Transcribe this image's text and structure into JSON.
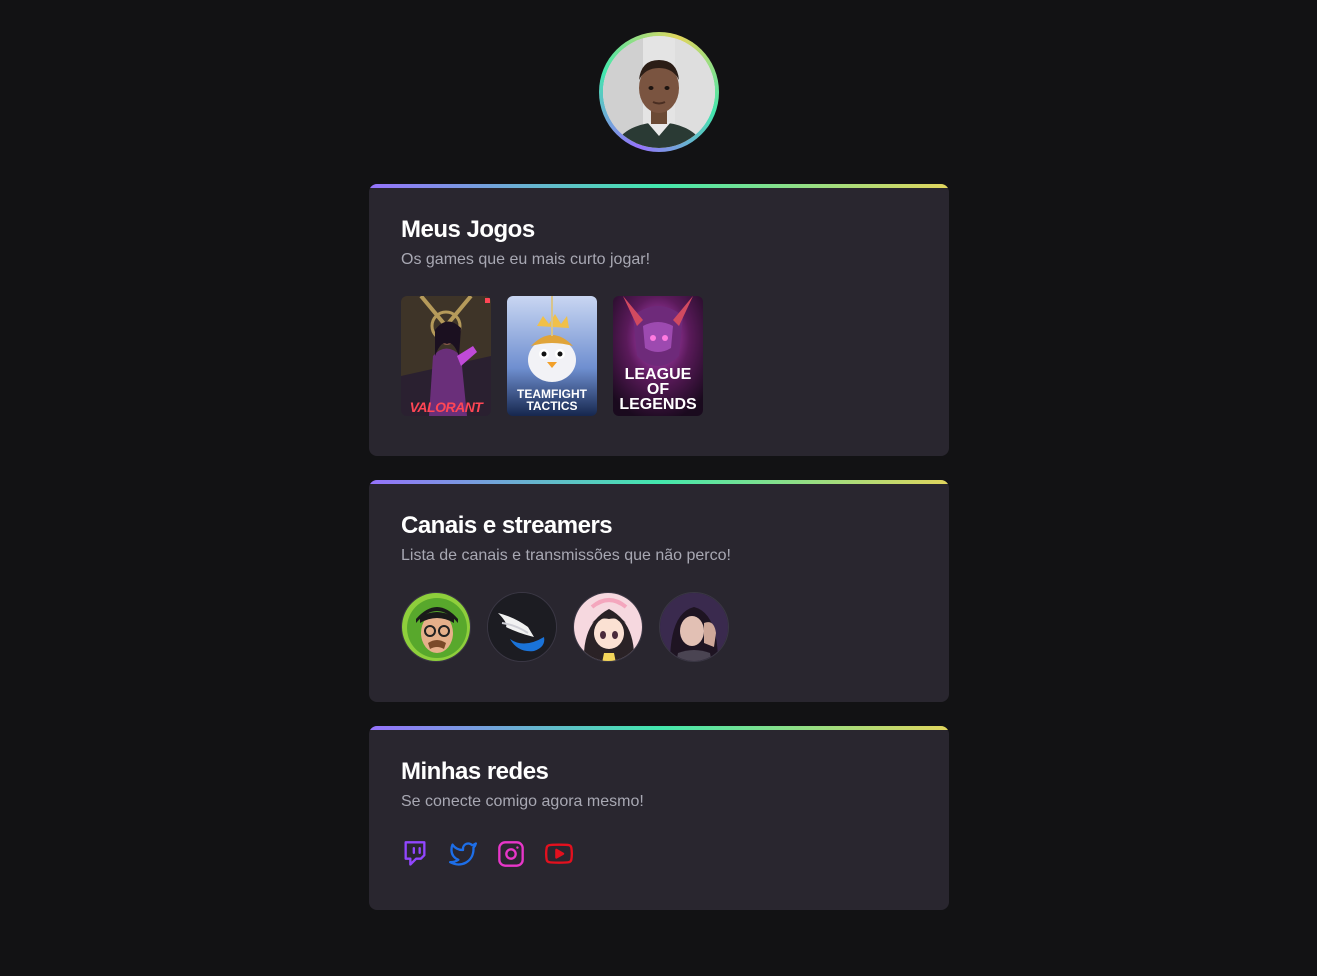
{
  "profile": {
    "avatar_icon": "profile-photo"
  },
  "sections": {
    "games": {
      "title": "Meus Jogos",
      "subtitle": "Os games que eu mais curto jogar!",
      "items": [
        {
          "name": "VALORANT"
        },
        {
          "name": "TEAMFIGHT TACTICS"
        },
        {
          "name": "LEAGUE OF LEGENDS"
        }
      ]
    },
    "channels": {
      "title": "Canais e streamers",
      "subtitle": "Lista de canais e transmissões que não perco!",
      "items": [
        {
          "icon": "streamer-avatar-1"
        },
        {
          "icon": "streamer-avatar-2"
        },
        {
          "icon": "streamer-avatar-3"
        },
        {
          "icon": "streamer-avatar-4"
        }
      ]
    },
    "socials": {
      "title": "Minhas redes",
      "subtitle": "Se conecte comigo agora mesmo!",
      "items": [
        {
          "icon": "twitch-icon",
          "color": "#9146ff"
        },
        {
          "icon": "twitter-icon",
          "color": "#1d6ee8"
        },
        {
          "icon": "instagram-icon",
          "color": "#e836c9"
        },
        {
          "icon": "youtube-icon",
          "color": "#e3101e"
        }
      ]
    }
  },
  "colors": {
    "background": "#121214",
    "card": "#29262f",
    "gradient": [
      "#9572fc",
      "#43e7ad",
      "#e1d55d"
    ]
  }
}
